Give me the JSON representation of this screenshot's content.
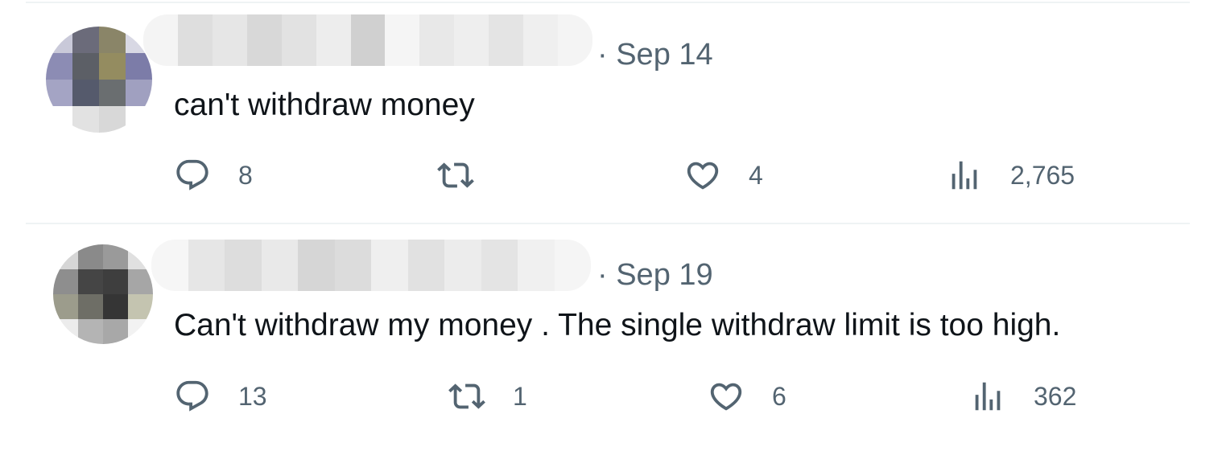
{
  "tweets": [
    {
      "timestamp": "· Sep 14",
      "text": "can't withdraw money",
      "actions": {
        "reply": {
          "icon": "reply-icon",
          "count": "8"
        },
        "retweet": {
          "icon": "retweet-icon",
          "count": ""
        },
        "like": {
          "icon": "heart-icon",
          "count": "4"
        },
        "views": {
          "icon": "views-icon",
          "count": "2,765"
        }
      }
    },
    {
      "timestamp": "· Sep 19",
      "text": "Can't withdraw my money . The single withdraw limit is too high.",
      "actions": {
        "reply": {
          "icon": "reply-icon",
          "count": "13"
        },
        "retweet": {
          "icon": "retweet-icon",
          "count": "1"
        },
        "like": {
          "icon": "heart-icon",
          "count": "6"
        },
        "views": {
          "icon": "views-icon",
          "count": "362"
        }
      }
    }
  ],
  "colors": {
    "secondary_text": "#536471",
    "primary_text": "#0f1419",
    "divider": "#eff3f4"
  }
}
